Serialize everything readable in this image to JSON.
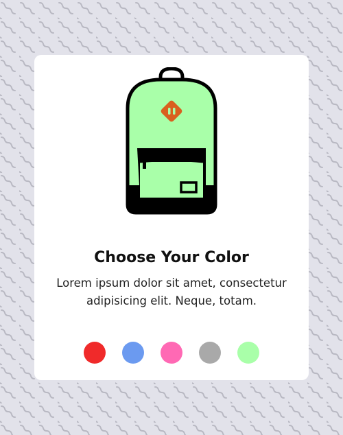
{
  "card": {
    "title": "Choose Your Color",
    "description": "Lorem ipsum dolor sit amet, consectetur adipisicing elit. Neque, totam."
  },
  "product": {
    "icon": "backpack-icon",
    "selected_color": "#a9ffa9"
  },
  "colors": [
    {
      "name": "red",
      "hex": "#f02a2a"
    },
    {
      "name": "blue",
      "hex": "#6b9af0"
    },
    {
      "name": "pink",
      "hex": "#ff69b4"
    },
    {
      "name": "gray",
      "hex": "#a9a9a9"
    },
    {
      "name": "green",
      "hex": "#a9ffa9"
    }
  ],
  "theme": {
    "page_bg": "#e2e2ea",
    "pattern_stroke": "#b8b8c2",
    "accent": "#d9601f"
  }
}
